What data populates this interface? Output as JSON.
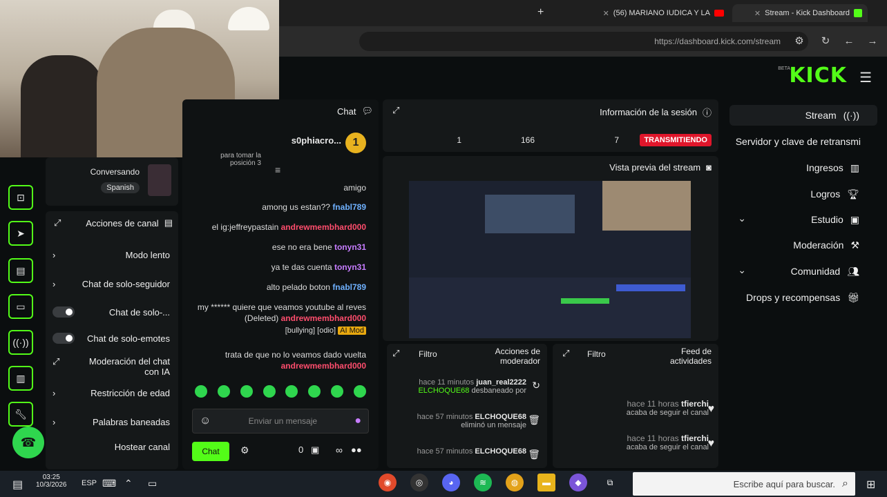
{
  "browser": {
    "tabs": [
      {
        "label": "Stream - Kick Dashboard"
      },
      {
        "label": "(56) MARIANO IUDICA Y LA"
      }
    ],
    "new_tab": "+",
    "url": "https://dashboard.kick.com/stream"
  },
  "kick": {
    "logo": "KICK",
    "beta": "BETA"
  },
  "sidebar": {
    "items": [
      {
        "label": "Stream",
        "icon": "broadcast-icon"
      },
      {
        "label": "Servidor y clave de retransmi",
        "icon": "key-icon"
      },
      {
        "label": "Ingresos",
        "icon": "chart-icon"
      },
      {
        "label": "Logros",
        "icon": "trophy-icon"
      },
      {
        "label": "Estudio",
        "icon": "studio-icon"
      },
      {
        "label": "Moderación",
        "icon": "hammer-icon"
      },
      {
        "label": "Comunidad",
        "icon": "users-icon"
      },
      {
        "label": "Drops y recompensas",
        "icon": "gift-icon"
      }
    ]
  },
  "session": {
    "title": "Información de la sesión",
    "status": "TRANSMITIENDO",
    "stats": [
      "7",
      "166",
      "1"
    ]
  },
  "preview": {
    "title": "Vista previa del stream"
  },
  "activity_feed": {
    "title": "Feed de actividades",
    "filter": "Filtro",
    "items": [
      {
        "user": "tfierchi",
        "time": "hace 11 horas",
        "text": "acaba de seguir el canal"
      },
      {
        "user": "tfierchi",
        "time": "hace 11 horas",
        "text": "acaba de seguir el canal"
      }
    ]
  },
  "mod_actions": {
    "title": "Acciones de moderador",
    "filter": "Filtro",
    "items": [
      {
        "user": "juan_real2222",
        "time": "hace 11 minutos",
        "text": "desbaneado por",
        "by": "ELCHOQUE68"
      },
      {
        "user": "ELCHOQUE68",
        "time": "hace 57 minutos",
        "text": "eliminó un mensaje"
      },
      {
        "user": "ELCHOQUE68",
        "time": "hace 57 minutos",
        "text": ""
      }
    ]
  },
  "chat": {
    "title": "Chat",
    "pinned_user": "s0phiacro...",
    "pinned_text": "para tomar la posición 3",
    "messages": [
      {
        "user": "",
        "text": "amigo",
        "cls": ""
      },
      {
        "user": "fnabl789",
        "text": "among us estan??",
        "cls": "u2"
      },
      {
        "user": "andrewmembhard000",
        "text": "el ig:jeffreypastain",
        "cls": "u1"
      },
      {
        "user": "tonyn31",
        "text": "ese no era bene",
        "cls": "u3"
      },
      {
        "user": "tonyn31",
        "text": "ya te das cuenta",
        "cls": "u3"
      },
      {
        "user": "fnabl789",
        "text": "alto pelado boton",
        "cls": "u2"
      },
      {
        "user": "andrewmembhard000",
        "text": "my ****** quiere que veamos youtube al reves (Deleted)",
        "cls": "u1"
      },
      {
        "user": "andrewmembhard000",
        "text": "trata de que no lo veamos dado vuelta",
        "cls": "u1"
      }
    ],
    "deleted_tag": "AI Mod",
    "deleted_reason": "[bullying] [odio]",
    "placeholder": "Enviar un mensaje",
    "send_label": "Chat",
    "count": "0"
  },
  "channel_actions": {
    "title": "Acciones de canal",
    "user_status": "Conversando",
    "user_lang": "Spanish",
    "rows": [
      {
        "label": "Modo lento"
      },
      {
        "label": "Chat de solo-seguidor"
      },
      {
        "label": "Chat de solo-..."
      },
      {
        "label": "Chat de solo-emotes"
      },
      {
        "label": "Moderación del chat con IA"
      },
      {
        "label": "Restricción de edad"
      },
      {
        "label": "Palabras baneadas"
      },
      {
        "label": "Hostear canal"
      }
    ]
  },
  "taskbar": {
    "search_placeholder": "Escribe aquí para buscar.",
    "time": "03:25",
    "date": "10/3/2026",
    "lang": "ESP"
  }
}
